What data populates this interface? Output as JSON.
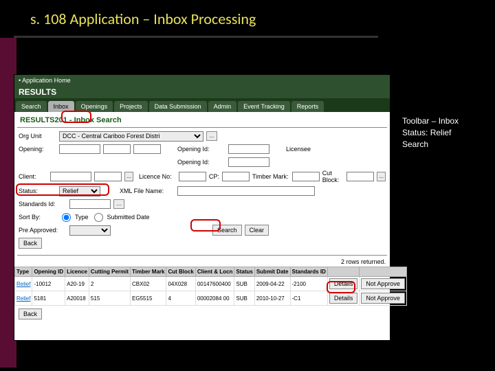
{
  "slide": {
    "title": "s. 108 Application – Inbox Processing"
  },
  "notes": {
    "line1": "Toolbar – Inbox",
    "line2": "Status: Relief",
    "line3": "Search"
  },
  "app": {
    "home_label": "• Application Home",
    "brand": "RESULTS",
    "toolbar": {
      "search": "Search",
      "inbox": "Inbox",
      "openings": "Openings",
      "projects": "Projects",
      "data_submission": "Data Submission",
      "admin": "Admin",
      "event_tracking": "Event Tracking",
      "reports": "Reports"
    },
    "page_title": "RESULTS201 - Inbox Search",
    "labels": {
      "org_unit": "Org Unit",
      "opening": "Opening:",
      "client": "Client:",
      "status": "Status:",
      "standards_id": "Standards Id:",
      "sort_by": "Sort By:",
      "pre_approved": "Pre Approved:",
      "opening_id": "Opening Id:",
      "licence_no": "Licence No:",
      "xml_file_name": "XML File Name:",
      "licensee": "Licensee",
      "cp": "CP:",
      "timber_mark": "Timber Mark:",
      "cut_block": "Cut Block:",
      "type": "Type",
      "submitted_date": "Submitted Date"
    },
    "values": {
      "org_unit": "DCC - Central Cariboo Forest Distri",
      "status": "Relief"
    },
    "buttons": {
      "search": "Search",
      "clear": "Clear",
      "back": "Back",
      "details": "Details",
      "not_approve": "Not Approve",
      "lookup": "..."
    },
    "results_count": "2 rows returned.",
    "table": {
      "headers": {
        "type": "Type",
        "opening_id": "Opening ID",
        "licence": "Licence",
        "cutting_permit": "Cutting Permit",
        "timber_mark": "Timber Mark",
        "cut_block": "Cut Block",
        "client_locn": "Client & Locn",
        "status": "Status",
        "submit_date": "Submit Date",
        "standards_id": "Standards ID"
      },
      "rows": [
        {
          "type": "Relief",
          "opening_id": "-10012",
          "licence": "A20-19",
          "cutting_permit": "2",
          "timber_mark": "CBX02",
          "cut_block": "04X028",
          "client_locn": "00147600400",
          "status": "SUB",
          "submit_date": "2009-04-22",
          "standards_id": "-2100"
        },
        {
          "type": "Relief",
          "opening_id": "5181",
          "licence": "A20018",
          "cutting_permit": "515",
          "timber_mark": "EG5515",
          "cut_block": "4",
          "client_locn": "00002084 00",
          "status": "SUB",
          "submit_date": "2010-10-27",
          "standards_id": "-C1"
        }
      ]
    }
  }
}
